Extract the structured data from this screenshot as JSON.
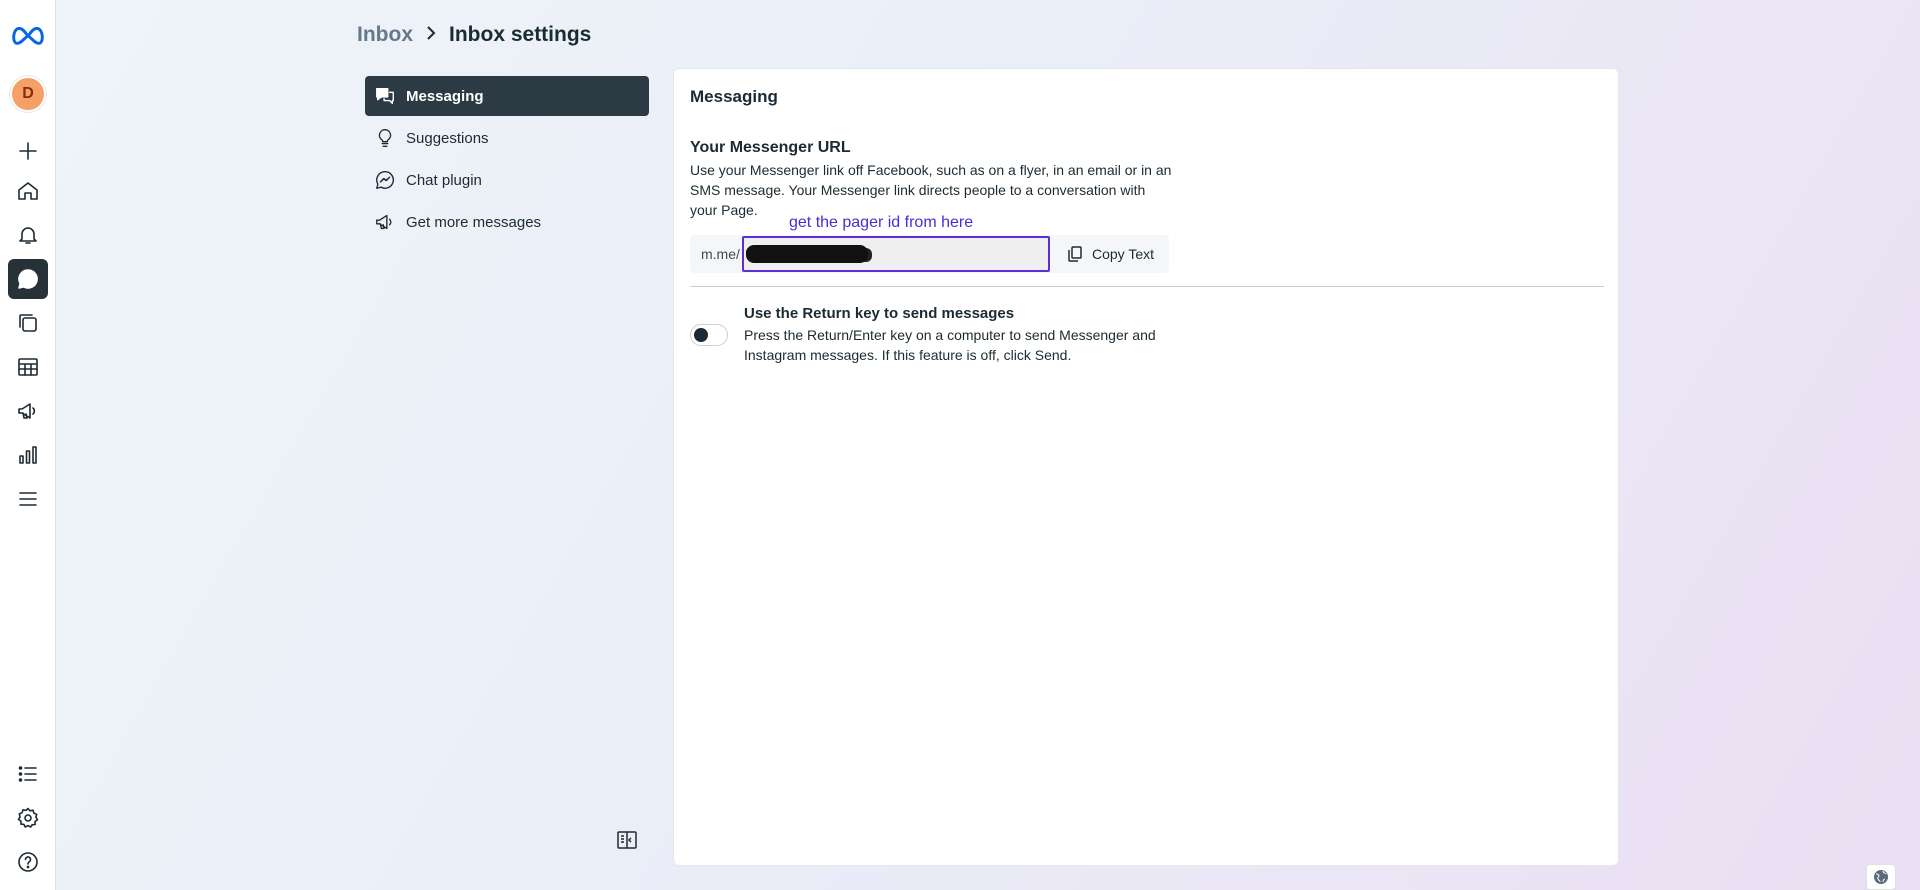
{
  "rail": {
    "avatar_initial": "D",
    "items": [
      {
        "name": "create",
        "icon": "plus-icon"
      },
      {
        "name": "home",
        "icon": "home-icon"
      },
      {
        "name": "notifications",
        "icon": "bell-icon"
      },
      {
        "name": "inbox",
        "icon": "chat-bubble-icon",
        "active": true
      },
      {
        "name": "content",
        "icon": "stack-icon"
      },
      {
        "name": "planner",
        "icon": "table-icon"
      },
      {
        "name": "ads",
        "icon": "megaphone-icon"
      },
      {
        "name": "insights",
        "icon": "bar-chart-icon"
      },
      {
        "name": "menu",
        "icon": "hamburger-icon"
      },
      {
        "name": "list",
        "icon": "list-icon"
      },
      {
        "name": "settings",
        "icon": "gear-icon"
      },
      {
        "name": "help",
        "icon": "help-icon"
      }
    ]
  },
  "breadcrumb": {
    "parent": "Inbox",
    "current": "Inbox settings"
  },
  "settings_nav": {
    "items": [
      {
        "label": "Messaging",
        "icon": "chat-bubbles-icon",
        "active": true
      },
      {
        "label": "Suggestions",
        "icon": "lightbulb-icon"
      },
      {
        "label": "Chat plugin",
        "icon": "messenger-icon"
      },
      {
        "label": "Get more messages",
        "icon": "megaphone-icon"
      }
    ]
  },
  "main": {
    "title": "Messaging",
    "messenger_url": {
      "title": "Your Messenger URL",
      "description": "Use your Messenger link off Facebook, such as on a flyer, in an email or in an SMS message. Your Messenger link directs people to a conversation with your Page.",
      "prefix": "m.me/",
      "annotation": "get the pager id from here",
      "copy_label": "Copy Text"
    },
    "return_key": {
      "title": "Use the Return key to send messages",
      "description": "Press the Return/Enter key on a computer to send Messenger and Instagram messages. If this feature is off, click Send.",
      "enabled": false
    }
  },
  "colors": {
    "accent": "#263238",
    "annotation": "#4b2bd6",
    "avatar": "#f5a067",
    "meta_blue": "#0668e1"
  }
}
